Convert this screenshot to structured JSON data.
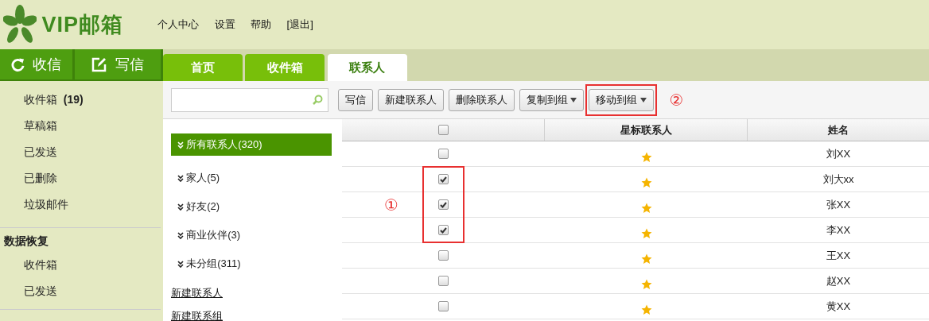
{
  "logo": {
    "text": "VIP邮箱"
  },
  "top_links": [
    "个人中心",
    "设置",
    "帮助",
    "[退出]"
  ],
  "action_buttons": [
    {
      "kind": "refresh",
      "label": "收信"
    },
    {
      "kind": "compose",
      "label": "写信"
    }
  ],
  "tabs": [
    {
      "label": "首页",
      "selected": false
    },
    {
      "label": "收件箱",
      "selected": false
    },
    {
      "label": "联系人",
      "selected": true
    }
  ],
  "sidebar": {
    "folders": [
      {
        "label": "收件箱",
        "count": "(19)"
      },
      {
        "label": "草稿箱"
      },
      {
        "label": "已发送"
      },
      {
        "label": "已删除"
      },
      {
        "label": "垃圾邮件"
      }
    ],
    "recovery_title": "数据恢复",
    "recovery_items": [
      "收件箱",
      "已发送"
    ]
  },
  "toolbar": [
    {
      "label": "写信",
      "dropdown": false,
      "highlighted": false
    },
    {
      "label": "新建联系人",
      "dropdown": false,
      "highlighted": false
    },
    {
      "label": "删除联系人",
      "dropdown": false,
      "highlighted": false
    },
    {
      "label": "复制到组",
      "dropdown": true,
      "highlighted": false
    },
    {
      "label": "移动到组",
      "dropdown": true,
      "highlighted": true
    }
  ],
  "toolbar_highlight_marker": "②",
  "groups": [
    {
      "label": "所有联系人(320)",
      "selected": true
    },
    {
      "label": "家人(5)",
      "selected": false
    },
    {
      "label": "好友(2)",
      "selected": false
    },
    {
      "label": "商业伙伴(3)",
      "selected": false
    },
    {
      "label": "未分组(311)",
      "selected": false
    }
  ],
  "group_links": [
    "新建联系人",
    "新建联系组"
  ],
  "table": {
    "header_checked": false,
    "columns": [
      "星标联系人",
      "姓名"
    ],
    "highlight_marker": "①",
    "rows": [
      {
        "checked": false,
        "highlighted": false,
        "starred": true,
        "name": "刘XX"
      },
      {
        "checked": true,
        "highlighted": true,
        "starred": true,
        "name": "刘大xx"
      },
      {
        "checked": true,
        "highlighted": true,
        "starred": true,
        "name": "张XX"
      },
      {
        "checked": true,
        "highlighted": true,
        "starred": true,
        "name": "李XX"
      },
      {
        "checked": false,
        "highlighted": false,
        "starred": true,
        "name": "王XX"
      },
      {
        "checked": false,
        "highlighted": false,
        "starred": true,
        "name": "赵XX"
      },
      {
        "checked": false,
        "highlighted": false,
        "starred": true,
        "name": "黄XX"
      }
    ]
  }
}
